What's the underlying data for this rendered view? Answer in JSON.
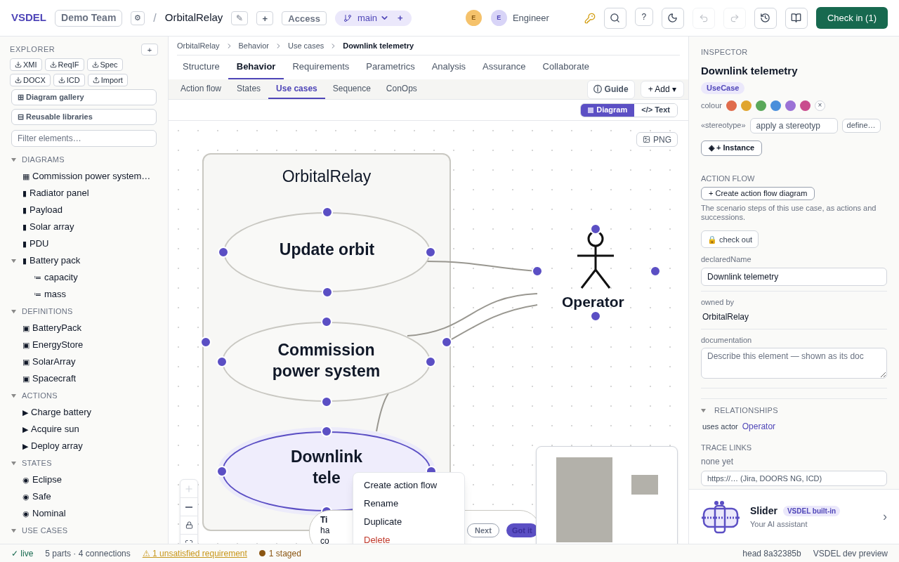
{
  "topbar": {
    "brand": "VSDEL",
    "team": "Demo Team",
    "settings_glyph": "⚙",
    "separator": "/",
    "project": "OrbitalRelay",
    "edit_glyph": "✎",
    "add_glyph": "+",
    "access": "Access",
    "branch": {
      "name": "main",
      "add": "+"
    },
    "avatar": "E",
    "user": {
      "initial": "E",
      "name": "Engineer"
    },
    "help": "?",
    "undo_disabled": true,
    "redo_disabled": true,
    "check_in": "Check in (1)"
  },
  "explorer": {
    "title": "EXPLORER",
    "add": "+",
    "exports": [
      {
        "label": "XMI",
        "kind": "download"
      },
      {
        "label": "ReqIF",
        "kind": "download"
      },
      {
        "label": "Spec",
        "kind": "download"
      },
      {
        "label": "DOCX",
        "kind": "download"
      },
      {
        "label": "ICD",
        "kind": "download"
      },
      {
        "label": "Import",
        "kind": "upload"
      }
    ],
    "gallery": "⊞ Diagram gallery",
    "libraries": "⊟ Reusable libraries",
    "filter_placeholder": "Filter elements…",
    "sections": [
      {
        "title": "DIAGRAMS",
        "expanded": true,
        "items": [
          {
            "icon": "▦",
            "label": "Commission power system…"
          },
          {
            "icon": "▮",
            "label": "Radiator panel"
          },
          {
            "icon": "▮",
            "label": "Payload"
          },
          {
            "icon": "▮",
            "label": "Solar array"
          },
          {
            "icon": "▮",
            "label": "PDU"
          },
          {
            "icon": "▮",
            "label": "Battery pack",
            "expanded": true,
            "children": [
              {
                "icon": "≔",
                "label": "capacity"
              },
              {
                "icon": "≔",
                "label": "mass"
              }
            ]
          }
        ]
      },
      {
        "title": "DEFINITIONS",
        "expanded": true,
        "items": [
          {
            "icon": "▣",
            "label": "BatteryPack"
          },
          {
            "icon": "▣",
            "label": "EnergyStore"
          },
          {
            "icon": "▣",
            "label": "SolarArray"
          },
          {
            "icon": "▣",
            "label": "Spacecraft"
          }
        ]
      },
      {
        "title": "ACTIONS",
        "expanded": true,
        "items": [
          {
            "icon": "▶",
            "label": "Charge battery"
          },
          {
            "icon": "▶",
            "label": "Acquire sun"
          },
          {
            "icon": "▶",
            "label": "Deploy array"
          }
        ]
      },
      {
        "title": "STATES",
        "expanded": true,
        "items": [
          {
            "icon": "◉",
            "label": "Eclipse"
          },
          {
            "icon": "◉",
            "label": "Safe"
          },
          {
            "icon": "◉",
            "label": "Nominal"
          }
        ]
      },
      {
        "title": "USE CASES",
        "expanded": true
      }
    ]
  },
  "breadcrumb": [
    "OrbitalRelay",
    "Behavior",
    "Use cases",
    "Downlink telemetry"
  ],
  "tabs": [
    {
      "label": "Structure",
      "selected": false
    },
    {
      "label": "Behavior",
      "selected": true
    },
    {
      "label": "Requirements",
      "selected": false
    },
    {
      "label": "Parametrics",
      "selected": false
    },
    {
      "label": "Analysis",
      "selected": false
    },
    {
      "label": "Assurance",
      "selected": false
    },
    {
      "label": "Collaborate",
      "selected": false
    }
  ],
  "subtabs": [
    {
      "label": "Action flow",
      "selected": false
    },
    {
      "label": "States",
      "selected": false
    },
    {
      "label": "Use cases",
      "selected": true
    },
    {
      "label": "Sequence",
      "selected": false
    },
    {
      "label": "ConOps",
      "selected": false
    }
  ],
  "guide": "ⓘ Guide",
  "add": "+ Add ▾",
  "view_toggle": [
    {
      "label": "Diagram",
      "selected": true
    },
    {
      "label": "</> Text",
      "selected": false
    }
  ],
  "png": "PNG",
  "canvas": {
    "system": "OrbitalRelay",
    "use_cases": [
      {
        "label": "Update orbit",
        "selected": false
      },
      {
        "label": "Commission power system",
        "selected": false
      },
      {
        "label": "Downlink tele",
        "selected": true
      }
    ],
    "actor": "Operator"
  },
  "tip": {
    "title": "Ti",
    "lines": [
      "ha",
      "co"
    ],
    "next": "Next",
    "got_it": "Got it"
  },
  "context_menu": [
    {
      "label": "Create action flow",
      "kind": "normal"
    },
    {
      "label": "Rename",
      "kind": "normal"
    },
    {
      "label": "Duplicate",
      "kind": "normal"
    },
    {
      "label": "Delete",
      "kind": "danger"
    }
  ],
  "inspector": {
    "title": "INSPECTOR",
    "name": "Downlink telemetry",
    "type": "UseCase",
    "colour_label": "colour",
    "colours": [
      {
        "color": "#e06c4c"
      },
      {
        "color": "#e0a52e"
      },
      {
        "color": "#5aa85a"
      },
      {
        "color": "#4a8fdb"
      },
      {
        "color": "#9b72d6"
      },
      {
        "color": "#c94d8e"
      }
    ],
    "clear": "×",
    "stereotype_label": "«stereotype»",
    "stereotype_placeholder": "apply a stereotyp",
    "define": "define…",
    "instance": "◈ + Instance",
    "action_flow_title": "ACTION FLOW",
    "create_flow": "+ Create action flow diagram",
    "flow_help": "The scenario steps of this use case, as actions and successions.",
    "check_out": "🔒 check out",
    "declared_label": "declaredName",
    "declared_value": "Downlink telemetry",
    "owned_label": "owned by",
    "owned_value": "OrbitalRelay",
    "doc_label": "documentation",
    "doc_placeholder": "Describe this element — shown as its doc",
    "relationships_title": "RELATIONSHIPS",
    "relationships_expanded": true,
    "relation": {
      "label": "uses actor",
      "target": "Operator"
    },
    "trace_title": "TRACE LINKS",
    "trace_empty": "none yet",
    "trace_placeholder": "https://… (Jira, DOORS NG, ICD)"
  },
  "assistant": {
    "name": "Slider",
    "badge": "VSDEL built-in",
    "subtitle": "Your AI assistant",
    "chevron": "›"
  },
  "status": {
    "live": "✓ live",
    "counts": "5 parts · 4 connections",
    "warning": "⚠ 1 unsatisfied requirement",
    "staged": "1 staged",
    "head": "head 8a32385b",
    "build": "VSDEL dev preview"
  }
}
